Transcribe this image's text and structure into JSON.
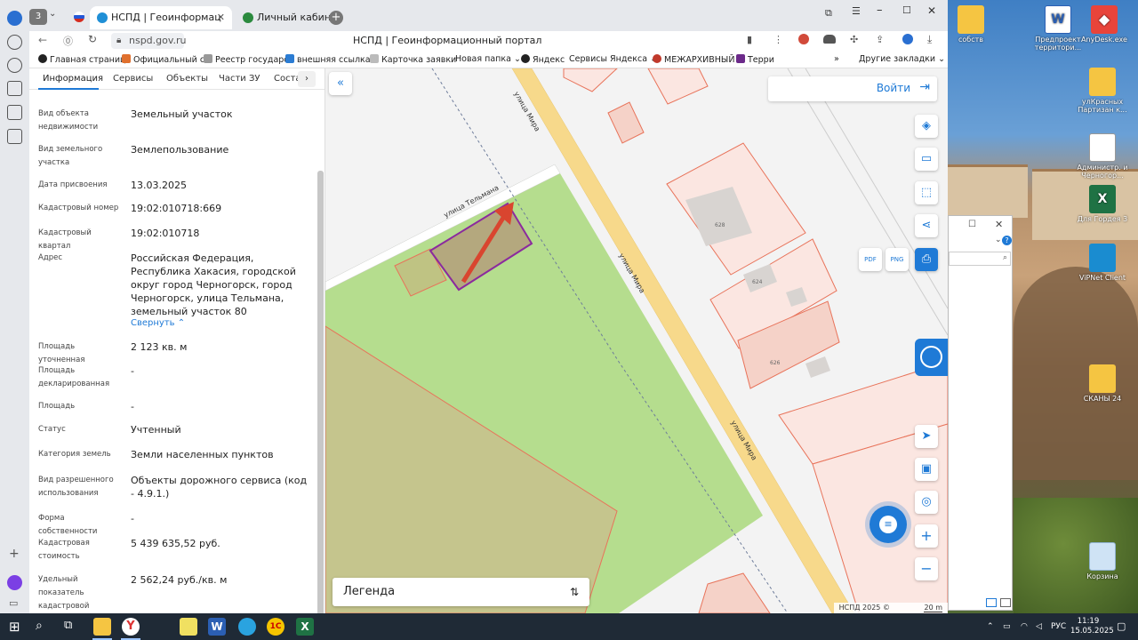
{
  "browser": {
    "tabs": [
      {
        "title": "НСПД | Геоинформац",
        "active": true
      },
      {
        "title": "Личный кабинет",
        "active": false
      }
    ],
    "tab_counter": "3",
    "address": "nspd.gov.ru",
    "page_title": "НСПД | Геоинформационный портал",
    "bookmarks": [
      "Главная страниц",
      "Официальный са",
      "Реестр государст",
      "внешняя ссылка",
      "Карточка заявки",
      "Новая папка",
      "Яндекс",
      "Сервисы Яндекса",
      "МЕЖАРХИВНЫЙ",
      "Терри",
      "Другие закладки"
    ]
  },
  "panel": {
    "tabs": [
      "Информация",
      "Сервисы",
      "Объекты",
      "Части ЗУ",
      "Соста"
    ],
    "rows": [
      {
        "label": "Вид объекта недвижимости",
        "value": "Земельный участок"
      },
      {
        "label": "Вид земельного участка",
        "value": "Землепользование"
      },
      {
        "label": "Дата присвоения",
        "value": "13.03.2025"
      },
      {
        "label": "Кадастровый номер",
        "value": "19:02:010718:669"
      },
      {
        "label": "Кадастровый квартал",
        "value": "19:02:010718"
      },
      {
        "label": "Адрес",
        "value": "Российская Федерация, Республика Хакасия, городской округ город Черногорск, город Черногорск, улица Тельмана, земельный участок 80"
      },
      {
        "label": "Площадь уточненная",
        "value": "2 123 кв. м"
      },
      {
        "label": "Площадь декларированная",
        "value": "-"
      },
      {
        "label": "Площадь",
        "value": "-"
      },
      {
        "label": "Статус",
        "value": "Учтенный"
      },
      {
        "label": "Категория земель",
        "value": "Земли населенных пунктов"
      },
      {
        "label": "Вид разрешенного использования",
        "value": "Объекты дорожного сервиса (код - 4.9.1.)"
      },
      {
        "label": "Форма собственности",
        "value": "-"
      },
      {
        "label": "Кадастровая стоимость",
        "value": "5 439 635,52 руб."
      },
      {
        "label": "Удельный показатель кадастровой стоимости",
        "value": "2 562,24 руб./кв. м"
      }
    ],
    "collapse_label": "Свернуть"
  },
  "map": {
    "login_label": "Войти",
    "legend_label": "Легенда",
    "street_telmana": "улица Тельмана",
    "street_mira": "улица Мира",
    "building_labels": [
      "628",
      "624",
      "626"
    ],
    "attribution": "НСПД 2025 ©",
    "scale": "20 m",
    "export_pdf": "PDF",
    "export_png": "PNG",
    "colors": {
      "green_zone": "#b5dd8e",
      "road": "#f7d98b",
      "parcel_border": "#e8735a",
      "selected_border": "#8b2a9e",
      "arrow": "#d9452f",
      "accent": "#1f7ad6"
    }
  },
  "desktop": {
    "icons": [
      {
        "label": "собств",
        "icon": "folder-icon"
      },
      {
        "label": "Предпроект территори...",
        "icon": "word-doc-icon"
      },
      {
        "label": "AnyDesk.exe",
        "icon": "anydesk-icon"
      },
      {
        "label": "улКрасных Партизан к...",
        "icon": "folder-icon"
      },
      {
        "label": "Администр. и Черногор...",
        "icon": "document-icon"
      },
      {
        "label": "Для Гордея 3",
        "icon": "excel-icon"
      },
      {
        "label": "ViPNet Client",
        "icon": "vipnet-icon"
      },
      {
        "label": "СКАНЫ 24",
        "icon": "folder-icon"
      },
      {
        "label": "Корзина",
        "icon": "recycle-bin-icon"
      }
    ]
  },
  "taskbar": {
    "language": "РУС",
    "time": "11:19",
    "date": "15.05.2025"
  }
}
